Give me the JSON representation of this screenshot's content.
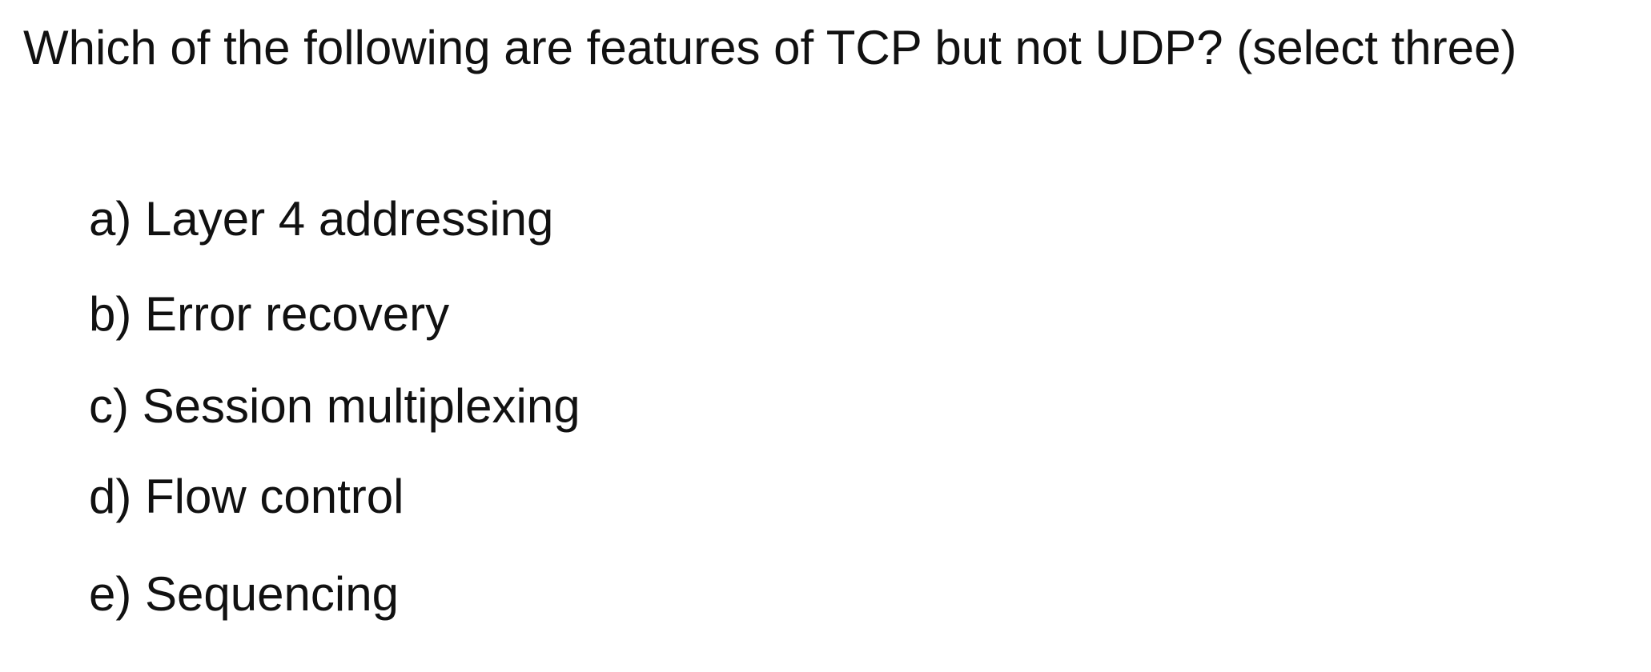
{
  "question": "Which of the following are features of TCP but not UDP? (select three)",
  "options": [
    "a) Layer 4 addressing",
    "b) Error recovery",
    "c) Session multiplexing",
    "d) Flow control",
    "e) Sequencing"
  ]
}
